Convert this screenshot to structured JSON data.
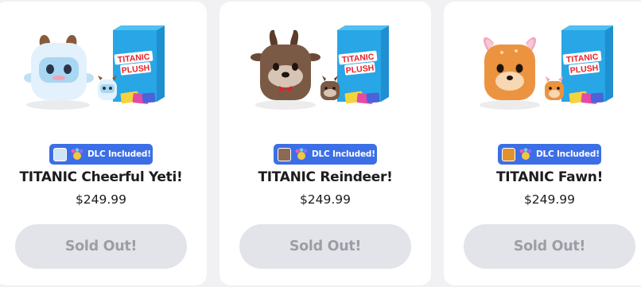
{
  "colors": {
    "page_background": "#f1f1f4",
    "card_background": "#ffffff",
    "badge_blue": "#3c6fe6",
    "sold_out_background": "#e3e4e9",
    "sold_out_text": "#9c9da6",
    "box_blue": "#28a6e6",
    "box_logo_red": "#e8242c"
  },
  "products": [
    {
      "box_logo_line1": "TITANIC",
      "box_logo_line2": "PLUSH",
      "dlc_label": "DLC Included!",
      "title": "TITANIC Cheerful Yeti!",
      "price": "$249.99",
      "button_label": "Sold Out!",
      "plush_color": "#e2f1fb"
    },
    {
      "box_logo_line1": "TITANIC",
      "box_logo_line2": "PLUSH",
      "dlc_label": "DLC Included!",
      "title": "TITANIC Reindeer!",
      "price": "$249.99",
      "button_label": "Sold Out!",
      "plush_color": "#7b5a45"
    },
    {
      "box_logo_line1": "TITANIC",
      "box_logo_line2": "PLUSH",
      "dlc_label": "DLC Included!",
      "title": "TITANIC Fawn!",
      "price": "$249.99",
      "button_label": "Sold Out!",
      "plush_color": "#ec9340"
    }
  ]
}
